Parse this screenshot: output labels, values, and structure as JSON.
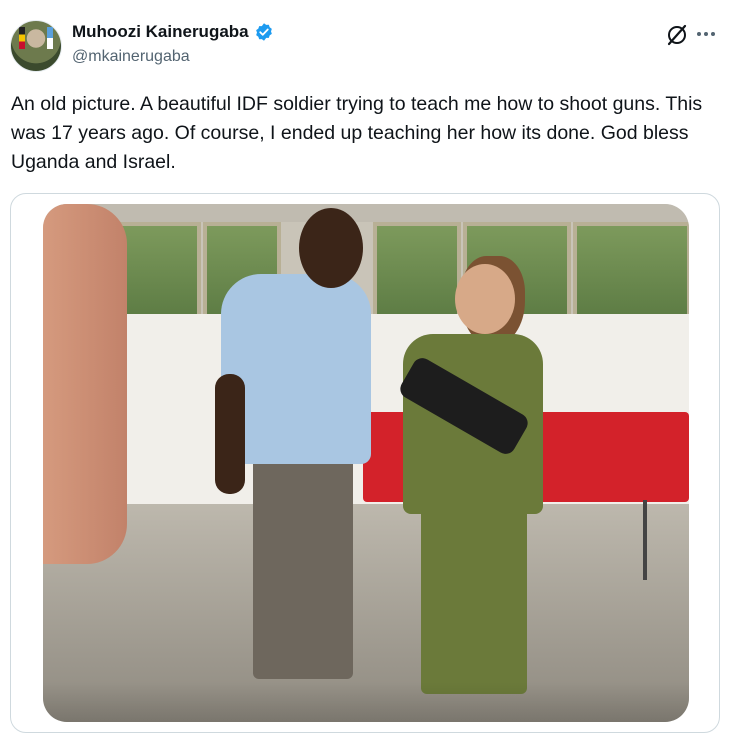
{
  "author": {
    "display_name": "Muhoozi Kainerugaba",
    "handle": "@mkainerugaba",
    "verified": true,
    "verified_color": "#1d9bf0"
  },
  "icons": {
    "grok": "grok-icon",
    "more": "more-icon",
    "verified": "verified-badge-icon"
  },
  "tweet": {
    "text": "An old picture. A beautiful IDF soldier trying to teach me how to shoot guns. This was 17 years ago. Of course, I ended up teaching her how its done. God bless Uganda and Israel."
  },
  "colors": {
    "text_primary": "#0f1419",
    "text_secondary": "#536471",
    "card_border": "#cfd9de",
    "table_red": "#d3222a",
    "uniform_green": "#6b7a3a"
  }
}
